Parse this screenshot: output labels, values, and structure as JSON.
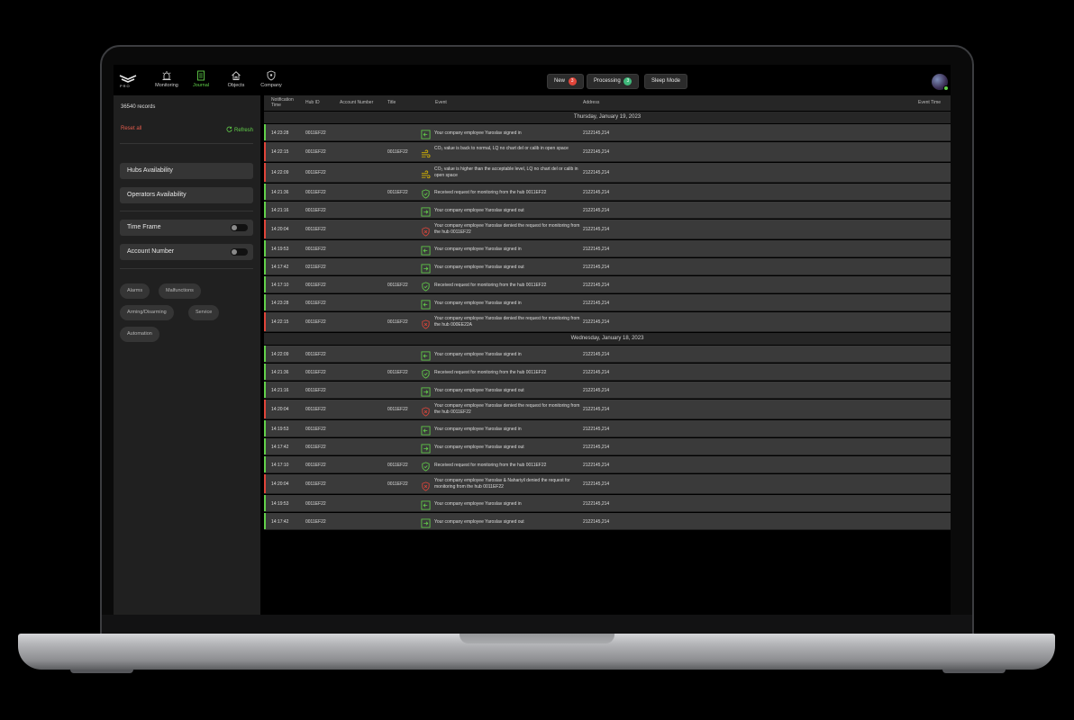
{
  "nav": {
    "logo_text": "PRO",
    "items": [
      {
        "label": "Monitoring",
        "icon": "siren-icon"
      },
      {
        "label": "Journal",
        "icon": "journal-icon"
      },
      {
        "label": "Objects",
        "icon": "house-icon"
      },
      {
        "label": "Company",
        "icon": "shield-icon"
      }
    ],
    "active": "Journal"
  },
  "status_pills": [
    {
      "label": "New",
      "count": "3",
      "badge_color": "#e0453a"
    },
    {
      "label": "Processing",
      "count": "3",
      "badge_color": "#3fb87a"
    },
    {
      "label": "Sleep Mode",
      "count": "",
      "badge_color": ""
    }
  ],
  "sidebar": {
    "records": "36540 records",
    "reset": "Reset all",
    "refresh": "Refresh",
    "buttons": [
      "Hubs Availability",
      "Operators Availability"
    ],
    "toggles": [
      "Time Frame",
      "Account Number"
    ],
    "chips": [
      "Alarms",
      "Malfunctions",
      "Arming/Disarming",
      "Service",
      "Automation"
    ]
  },
  "table": {
    "columns": [
      "Notification Time",
      "Hub ID",
      "Account Number",
      "Title",
      "Event",
      "Address",
      "Event Time"
    ],
    "groups": [
      {
        "date": "Thursday, January 19, 2023",
        "rows": [
          {
            "time": "14:23:28",
            "hub": "0011EF22",
            "account": "",
            "event": "Your company employee Yaroslav signed in",
            "address": "2122145,214",
            "icon": "sign-in-icon",
            "status": "green"
          },
          {
            "time": "14:22:15",
            "hub": "0011EF22",
            "account": "0011EF22",
            "event": "CO₂ value is back to normal, LQ no chart del or calib in open space",
            "address": "2122145,214",
            "icon": "co2-icon",
            "status": "red"
          },
          {
            "time": "14:22:09",
            "hub": "0011EF22",
            "account": "",
            "event": "CO₂ value is higher than the acceptable level, LQ no chart del or calib in open space",
            "address": "2122145,214",
            "icon": "co2-icon",
            "status": "red"
          },
          {
            "time": "14:21:36",
            "hub": "0011EF22",
            "account": "0011EF22",
            "event": "Received request for monitoring from the hub 0011EF22",
            "address": "2122145,214",
            "icon": "shield-check-icon",
            "status": "green"
          },
          {
            "time": "14:21:16",
            "hub": "0011EF22",
            "account": "",
            "event": "Your company employee Yaroslav signed out",
            "address": "2122145,214",
            "icon": "sign-out-icon",
            "status": "green"
          },
          {
            "time": "14:20:04",
            "hub": "0011EF22",
            "account": "",
            "event": "Your company employee Yaroslav denied the request for monitoring from the hub 0011EF22",
            "address": "2122145,214",
            "icon": "shield-x-icon",
            "status": "red"
          },
          {
            "time": "14:19:53",
            "hub": "0011EF22",
            "account": "",
            "event": "Your company employee Yaroslav signed in",
            "address": "2122145,214",
            "icon": "sign-in-icon",
            "status": "green"
          },
          {
            "time": "14:17:42",
            "hub": "0211EF22",
            "account": "",
            "event": "Your company employee Yaroslav signed out",
            "address": "2122145,214",
            "icon": "sign-out-icon",
            "status": "green"
          },
          {
            "time": "14:17:10",
            "hub": "0011EF22",
            "account": "0011EF22",
            "event": "Received request for monitoring from the hub 0011EF22",
            "address": "2122145,214",
            "icon": "shield-check-icon",
            "status": "green"
          },
          {
            "time": "14:23:28",
            "hub": "0011EF22",
            "account": "",
            "event": "Your company employee Yaroslav signed in",
            "address": "2122145,214",
            "icon": "sign-in-icon",
            "status": "green"
          },
          {
            "time": "14:22:15",
            "hub": "0011EF22",
            "account": "0011EF22",
            "event": "Your company employee Yaroslav denied the request for monitoring from the hub 000EE22A",
            "address": "2122145,214",
            "icon": "shield-x-icon",
            "status": "red"
          }
        ]
      },
      {
        "date": "Wednesday, January 18, 2023",
        "rows": [
          {
            "time": "14:22:09",
            "hub": "0011EF22",
            "account": "",
            "event": "Your company employee Yaroslav signed in",
            "address": "2122145,214",
            "icon": "sign-in-icon",
            "status": "green"
          },
          {
            "time": "14:21:36",
            "hub": "0011EF22",
            "account": "0011EF22",
            "event": "Received request for monitoring from the hub 0011EF22",
            "address": "2122145,214",
            "icon": "shield-check-icon",
            "status": "green"
          },
          {
            "time": "14:21:16",
            "hub": "0011EF22",
            "account": "",
            "event": "Your company employee Yaroslav signed out",
            "address": "2122145,214",
            "icon": "sign-out-icon",
            "status": "green"
          },
          {
            "time": "14:20:04",
            "hub": "0011EF22",
            "account": "0011EF22",
            "event": "Your company employee Yaroslav denied the request for monitoring from the hub 0011EF22",
            "address": "2122145,214",
            "icon": "shield-x-icon",
            "status": "red"
          },
          {
            "time": "14:19:53",
            "hub": "0011EF22",
            "account": "",
            "event": "Your company employee Yaroslav signed in",
            "address": "2122145,214",
            "icon": "sign-in-icon",
            "status": "green"
          },
          {
            "time": "14:17:42",
            "hub": "0011EF22",
            "account": "",
            "event": "Your company employee Yaroslav signed out",
            "address": "2122145,214",
            "icon": "sign-out-icon",
            "status": "green"
          },
          {
            "time": "14:17:10",
            "hub": "0011EF22",
            "account": "0011EF22",
            "event": "Received request for monitoring from the hub 0011EF22",
            "address": "2122145,214",
            "icon": "shield-check-icon",
            "status": "green"
          },
          {
            "time": "14:20:04",
            "hub": "0011EF22",
            "account": "0011EF22",
            "event": "Your company employee Yaroslav & Nahariyil denied the request for monitoring from the hub 0011EF22",
            "address": "2122145,214",
            "icon": "shield-x-icon",
            "status": "red"
          },
          {
            "time": "14:19:53",
            "hub": "0011EF22",
            "account": "",
            "event": "Your company employee Yaroslav signed in",
            "address": "2122145,214",
            "icon": "sign-in-icon",
            "status": "green"
          },
          {
            "time": "14:17:42",
            "hub": "0011EF22",
            "account": "",
            "event": "Your company employee Yaroslav signed out",
            "address": "2122145,214",
            "icon": "sign-out-icon",
            "status": "green"
          }
        ]
      }
    ]
  },
  "colors": {
    "accent_green": "#62d04a",
    "alert_red": "#e0453a",
    "warn_yellow": "#d8b400"
  }
}
